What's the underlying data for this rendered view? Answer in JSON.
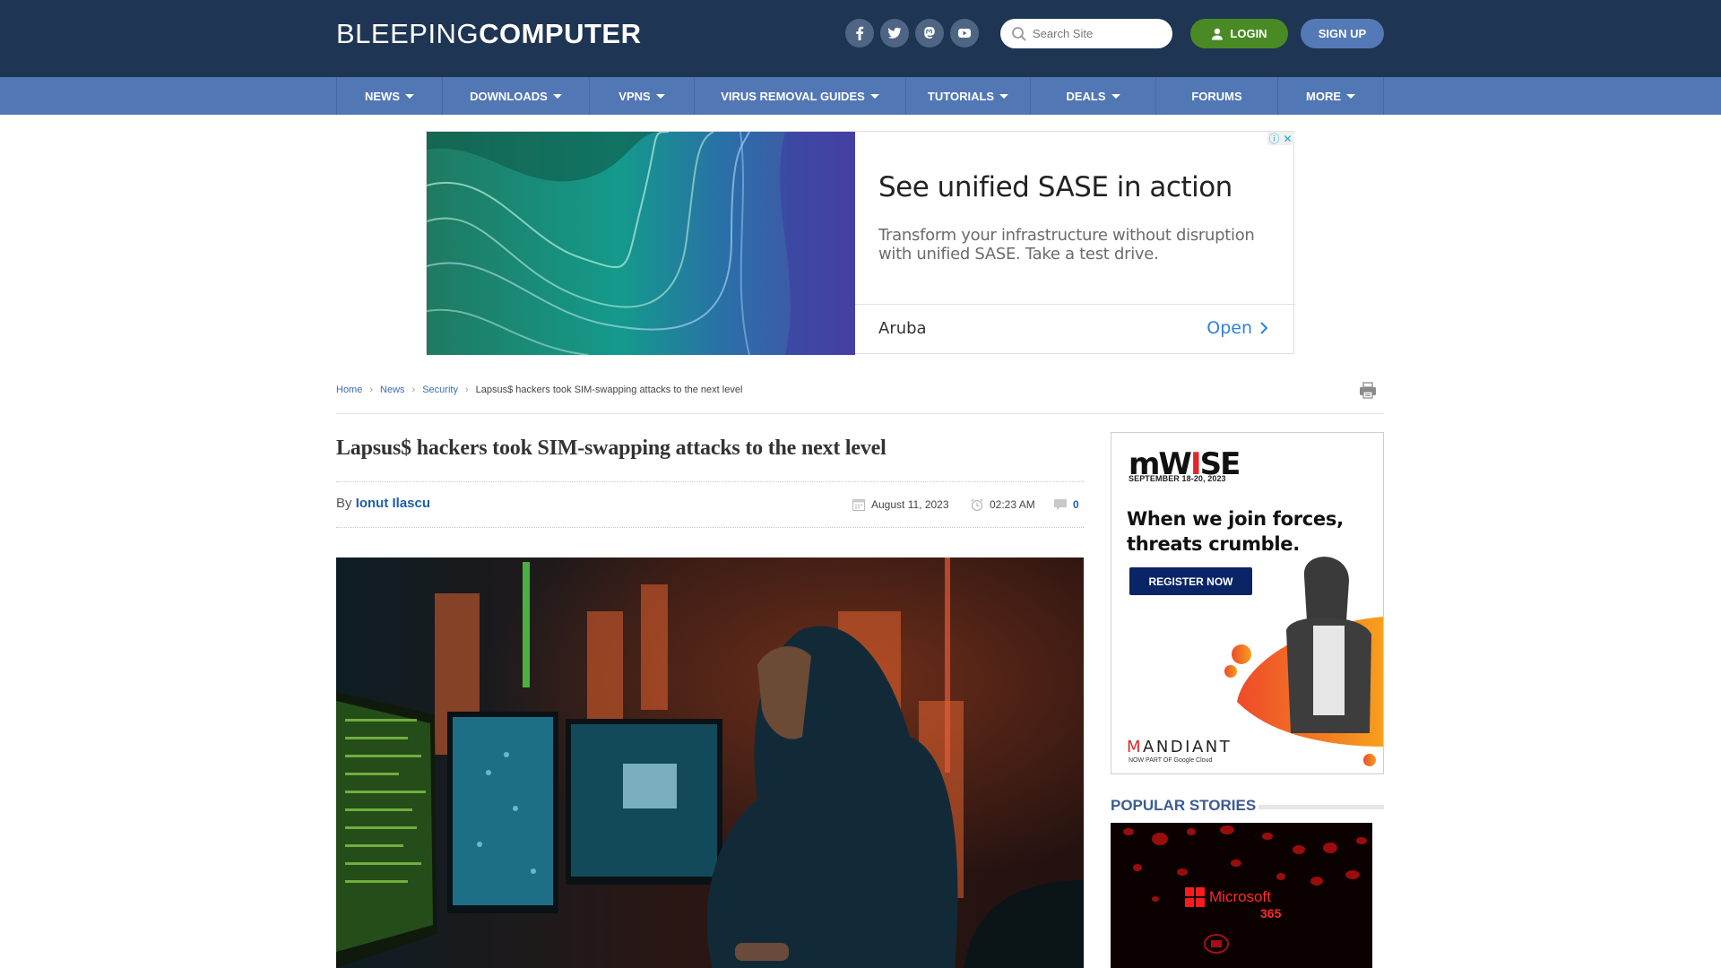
{
  "header": {
    "logo_light": "BLEEPING",
    "logo_bold": "COMPUTER",
    "social": [
      {
        "name": "facebook",
        "icon": "facebook-icon"
      },
      {
        "name": "twitter",
        "icon": "twitter-icon"
      },
      {
        "name": "mastodon",
        "icon": "mastodon-icon"
      },
      {
        "name": "youtube",
        "icon": "youtube-icon"
      }
    ],
    "search_placeholder": "Search Site",
    "login_label": "LOGIN",
    "signup_label": "SIGN UP",
    "colors": {
      "header_bg": "#1e3553",
      "nav_bg": "#5177b4",
      "login": "#4a8a24",
      "signup": "#5479b6"
    }
  },
  "nav": {
    "items": [
      {
        "label": "NEWS",
        "dropdown": true
      },
      {
        "label": "DOWNLOADS",
        "dropdown": true
      },
      {
        "label": "VPNS",
        "dropdown": true
      },
      {
        "label": "VIRUS REMOVAL GUIDES",
        "dropdown": true
      },
      {
        "label": "TUTORIALS",
        "dropdown": true
      },
      {
        "label": "DEALS",
        "dropdown": true
      },
      {
        "label": "FORUMS",
        "dropdown": false
      },
      {
        "label": "MORE",
        "dropdown": true
      }
    ]
  },
  "top_ad": {
    "headline": "See unified SASE in action",
    "body": "Transform your infrastructure without disruption with unified SASE. Take a test drive.",
    "advertiser": "Aruba",
    "cta": "Open",
    "info_glyph": "ⓘ",
    "close_glyph": "✕"
  },
  "breadcrumb": {
    "items": [
      "Home",
      "News",
      "Security"
    ],
    "current": "Lapsus$ hackers took SIM-swapping attacks to the next level"
  },
  "article": {
    "title": "Lapsus$ hackers took SIM-swapping attacks to the next level",
    "by_label": "By",
    "author": "Ionut Ilascu",
    "date": "August 11, 2023",
    "time": "02:23 AM",
    "comments": "0"
  },
  "sidebar_ad": {
    "brand_pre": "mW",
    "brand_i": "I",
    "brand_post": "SE",
    "date": "SEPTEMBER 18-20, 2023",
    "headline_1": "When we join forces,",
    "headline_2": "threats crumble.",
    "cta": "REGISTER NOW",
    "sponsor_m": "M",
    "sponsor_rest": "ANDIANT",
    "sponsor_sub": "NOW PART OF Google Cloud"
  },
  "popular": {
    "heading": "POPULAR STORIES",
    "story_image_text_1": "Microsoft",
    "story_image_text_2": "365"
  }
}
